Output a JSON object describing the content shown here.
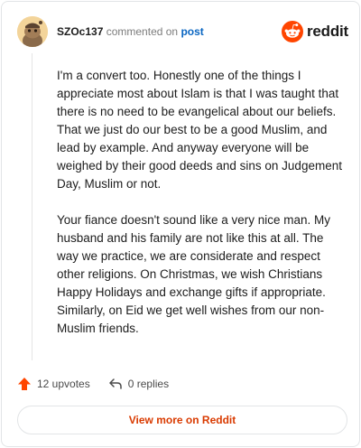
{
  "header": {
    "username": "SZOc137",
    "action_text": "commented on",
    "post_link": "post",
    "avatar_icon": "snoo-avatar-icon",
    "brand_logo_text": "reddit",
    "brand_color": "#ff4500"
  },
  "comment": {
    "paragraphs": [
      "I'm a convert too. Honestly one of the things I appreciate most about Islam is that I was taught that there is no need to be evangelical about our beliefs. That we just do our best to be a good Muslim, and lead by example. And anyway everyone will be weighed by their good deeds and sins on Judgement Day, Muslim or not.",
      "Your fiance doesn't sound like a very nice man. My husband and his family are not like this at all. The way we practice, we are considerate and respect other religions. On Christmas, we wish Christians Happy Holidays and exchange gifts if appropriate. Similarly, on Eid we get well wishes from our non-Muslim friends."
    ]
  },
  "footer": {
    "upvotes": "12 upvotes",
    "replies": "0 replies",
    "upvote_icon": "upvote-arrow-icon",
    "reply_icon": "reply-arrow-icon"
  },
  "view_more_label": "View more on Reddit"
}
